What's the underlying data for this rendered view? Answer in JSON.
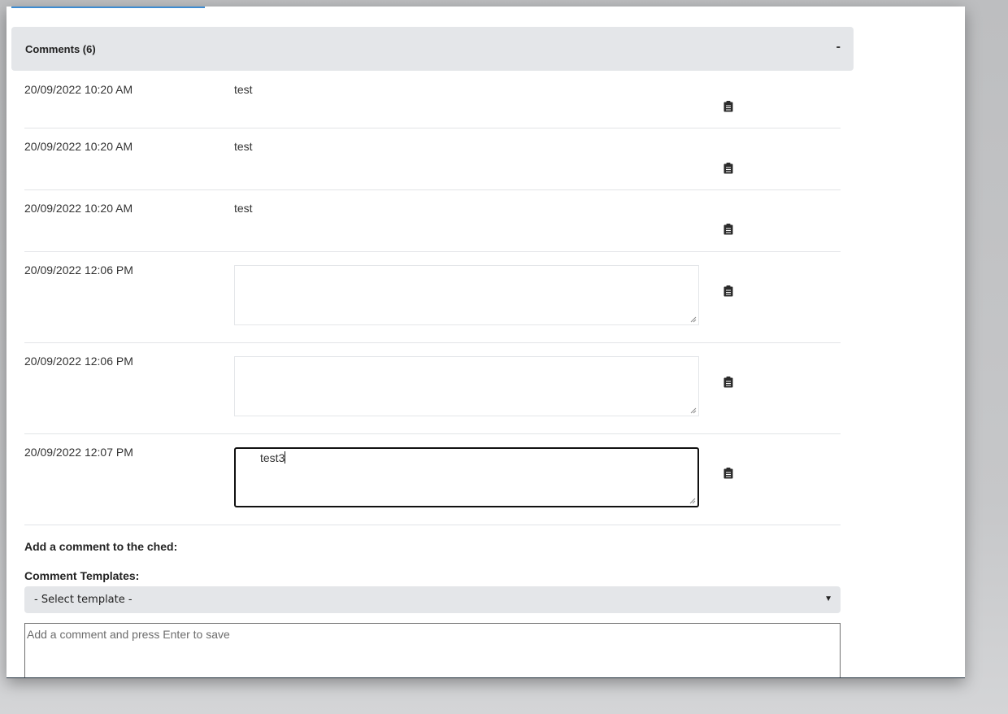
{
  "comments_section": {
    "title": "Comments (6)",
    "toggle_symbol": "-",
    "entries": [
      {
        "date": "20/09/2022 10:20 AM",
        "text": "test"
      },
      {
        "date": "20/09/2022 10:20 AM",
        "text": "test"
      },
      {
        "date": "20/09/2022 10:20 AM",
        "text": "test"
      },
      {
        "date": "20/09/2022 12:06 PM",
        "text": ""
      },
      {
        "date": "20/09/2022 12:06 PM",
        "text": ""
      },
      {
        "date": "20/09/2022 12:07 PM",
        "text": "test3"
      }
    ]
  },
  "add_comment": {
    "heading": "Add a comment to the ched:",
    "templates_label": "Comment Templates:",
    "template_select_value": "- Select template -",
    "placeholder": "Add a comment and press Enter to save"
  },
  "icons": {
    "copy_icon": "clipboard-icon",
    "dropdown_icon": "caret-down-icon"
  },
  "colors": {
    "header_bg": "#e4e6e9",
    "tab_accent": "#3d8bd1",
    "footer_bar": "#243240"
  }
}
